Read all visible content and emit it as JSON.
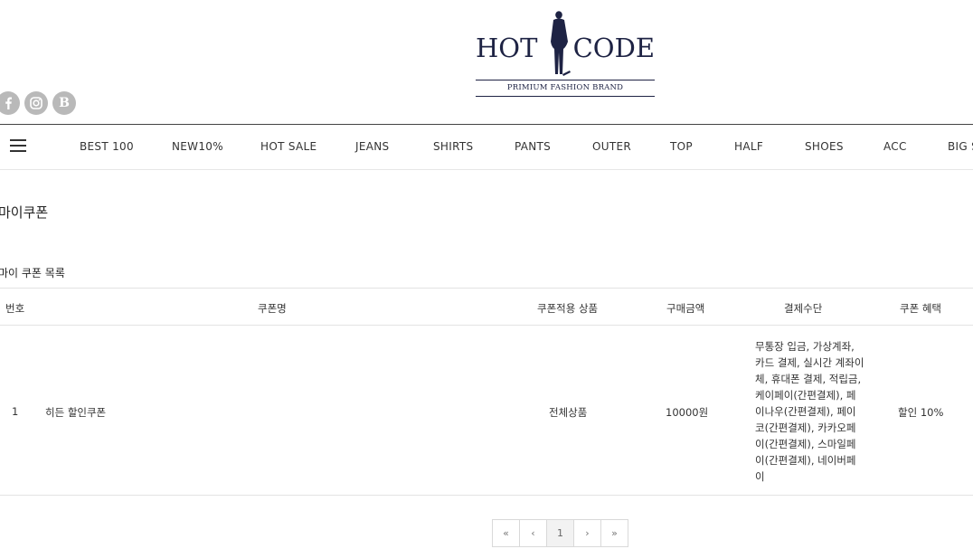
{
  "header": {
    "logo_text_left": "HOT",
    "logo_text_right": "CODE",
    "logo_sub": "PRIMIUM FASHION BRAND",
    "social_b": "B"
  },
  "nav": {
    "items": [
      "BEST 100",
      "NEW10%",
      "HOT SALE",
      "JEANS",
      "SHIRTS",
      "PANTS",
      "OUTER",
      "TOP",
      "HALF",
      "SHOES",
      "ACC",
      "BIG SIZE"
    ]
  },
  "page": {
    "title": "마이쿠폰",
    "section_title": "마이 쿠폰 목록"
  },
  "table": {
    "headers": [
      "번호",
      "쿠폰명",
      "쿠폰적용 상품",
      "구매금액",
      "결제수단",
      "쿠폰 혜택"
    ],
    "rows": [
      {
        "no": "1",
        "name": "히든 할인쿠폰",
        "product": "전체상품",
        "amount": "10000원",
        "payment": "무통장 입금, 가상계좌, 카드 결제, 실시간 계좌이체, 휴대폰 결제, 적립금, 케이페이(간편결제), 페이나우(간편결제), 페이코(간편결제), 카카오페이(간편결제), 스마일페이(간편결제), 네이버페이",
        "benefit": "할인 10%"
      }
    ]
  },
  "pagination": {
    "first": "«",
    "prev": "‹",
    "current": "1",
    "next": "›",
    "last": "»"
  },
  "colors": {
    "brand_navy": "#1e2344",
    "social_gray": "#b9b9b9"
  }
}
